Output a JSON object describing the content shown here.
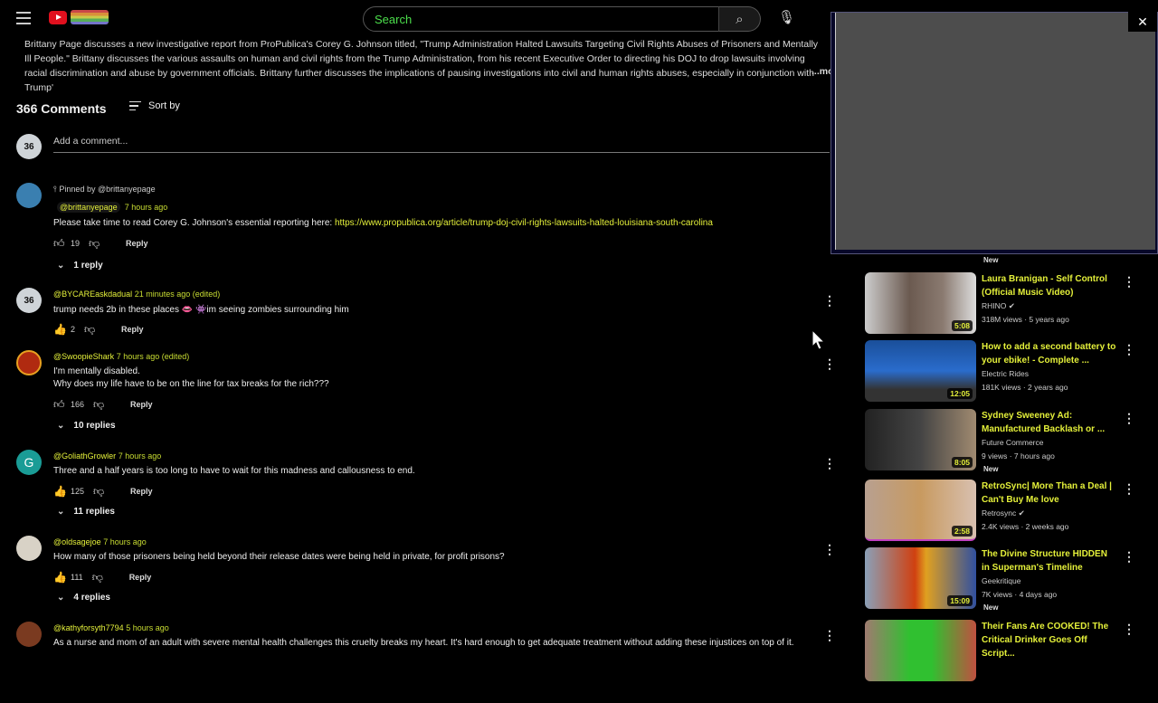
{
  "header": {
    "search_placeholder": "Search"
  },
  "description": {
    "text": "Brittany Page discusses a new investigative report from ProPublica's Corey G. Johnson titled, \"Trump Administration Halted Lawsuits Targeting Civil Rights Abuses of Prisoners and Mentally Ill People.\" Brittany discusses the various assaults on human and civil rights from the Trump Administration, from his recent Executive Order to directing his DOJ to drop lawsuits involving racial discrimination and abuse by government officials. Brittany further discusses the implications of pausing investigations into civil and human rights abuses, especially in conjunction with Trump'",
    "more": "...more"
  },
  "comments_header": {
    "count": "366 Comments",
    "sort": "Sort by",
    "add_placeholder": "Add a comment...",
    "avatar_text": "36"
  },
  "comments": [
    {
      "pinned": "Pinned by @brittanyepage",
      "author": "@brittanyepage",
      "time": "7 hours ago",
      "text": "Please take time to read Corey G. Johnson's essential reporting here: ",
      "link": "https://www.propublica.org/article/trump-doj-civil-rights-lawsuits-halted-louisiana-south-carolina",
      "likes": "19",
      "reply": "Reply",
      "replies": "1 reply"
    },
    {
      "author": "@BYCAREaskdadual",
      "time": "21 minutes ago (edited)",
      "text": "trump needs 2b in these places 👄 👾im seeing zombies surrounding him",
      "likes": "2",
      "reply": "Reply",
      "avatar_text": "36"
    },
    {
      "author": "@SwoopieShark",
      "time": "7 hours ago (edited)",
      "text": "I'm mentally disabled.",
      "text2": "Why does my life have to be on the line for tax breaks for the rich???",
      "likes": "166",
      "reply": "Reply",
      "replies": "10 replies"
    },
    {
      "author": "@GoliathGrowler",
      "time": "7 hours ago",
      "text": "Three and a half years is too long to have to wait for this madness and callousness to end.",
      "likes": "125",
      "reply": "Reply",
      "replies": "11 replies",
      "avatar_text": "G"
    },
    {
      "author": "@oldsagejoe",
      "time": "7 hours ago",
      "text": "How many of those prisoners being held beyond their release dates were being held in private, for profit prisons?",
      "likes": "111",
      "reply": "Reply",
      "replies": "4 replies"
    },
    {
      "author": "@kathyforsyth7794",
      "time": "5 hours ago",
      "text": "As a nurse and mom of an adult with severe mental health challenges this cruelty breaks my heart. It's hard enough to get adequate treatment without adding these injustices on top of it."
    }
  ],
  "sidebar": {
    "partial_new": "New",
    "videos": [
      {
        "title": "Laura Branigan - Self Control (Official Music Video)",
        "channel": "RHINO ✔",
        "meta": "318M views · 5 years ago",
        "duration": "5:08"
      },
      {
        "title": "How to add a second battery to your ebike! - Complete ...",
        "channel": "Electric Rides",
        "meta": "181K views · 2 years ago",
        "duration": "12:05"
      },
      {
        "title": "Sydney Sweeney Ad: Manufactured Backlash or ...",
        "channel": "Future Commerce",
        "meta": "9 views · 7 hours ago",
        "new": "New",
        "duration": "8:05"
      },
      {
        "title": "RetroSync| More Than a Deal | Can't Buy Me love",
        "channel": "Retrosync ✔",
        "meta": "2.4K views · 2 weeks ago",
        "duration": "2:58"
      },
      {
        "title": "The Divine Structure HIDDEN in Superman's Timeline",
        "channel": "Geekritique",
        "meta": "7K views · 4 days ago",
        "new": "New",
        "duration": "15:09"
      },
      {
        "title": "Their Fans Are COOKED! The Critical Drinker Goes Off Script..."
      }
    ]
  },
  "miniplayer": {
    "close": "✕"
  }
}
